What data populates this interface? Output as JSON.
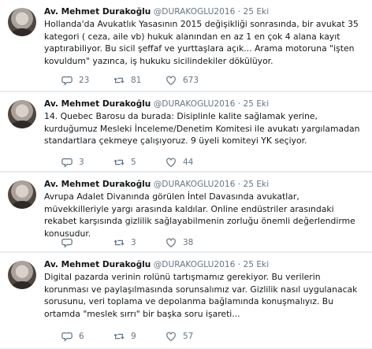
{
  "account": {
    "display_name": "Av. Mehmet Durakoğlu",
    "handle": "@DURAKOGLU2016",
    "separator": "·"
  },
  "icons": {
    "reply": "reply-icon",
    "retweet": "retweet-icon",
    "like": "heart-icon"
  },
  "colors": {
    "text": "#14171a",
    "muted": "#657786",
    "background": "#e6ecf0"
  },
  "tweets": [
    {
      "date": "25 Eki",
      "text": "Hollanda'da Avukatlık Yasasının 2015 değişikliği sonrasında, bir avukat 35 kategori ( ceza, aile vb) hukuk alanından en az 1 en çok 4 alana kayıt yaptırabiliyor. Bu sicil şeffaf ve yurttaşlara açık... Arama motoruna \"işten kovuldum\" yazınca, iş hukuku sicilindekiler dökülüyor.",
      "replies": "23",
      "retweets": "81",
      "likes": "673"
    },
    {
      "date": "25 Eki",
      "text": "14.  Quebec Barosu da burada: Disiplinle kalite sağlamak yerine, kurduğumuz Mesleki İnceleme/Denetim Komitesi ile avukatı yargılamadan standartlara çekmeye çalışıyoruz. 9 üyeli komiteyi YK seçiyor.",
      "replies": "3",
      "retweets": "5",
      "likes": "44"
    },
    {
      "date": "25 Eki",
      "text": "Avrupa Adalet Divanında görülen İntel Davasında avukatlar, müvekkilleriyle yargı arasında kaldılar. Online endüstriler arasındaki rekabet karşısında gizlilik sağlayabilmenin zorluğu önemli değerlendirme konusudur.",
      "replies": "",
      "retweets": "3",
      "likes": "38"
    },
    {
      "date": "25 Eki",
      "text": "Digital pazarda verinin rolünü tartışmamız gerekiyor. Bu verilerin korunması ve paylaşılmasında sorunsalımız var. Gizlilik nasıl uygulanacak sorusunu, veri toplama ve depolanma bağlamında konuşmalıyız. Bu ortamda \"meslek sırrı\" bir başka soru işareti...",
      "replies": "6",
      "retweets": "9",
      "likes": "57"
    }
  ]
}
